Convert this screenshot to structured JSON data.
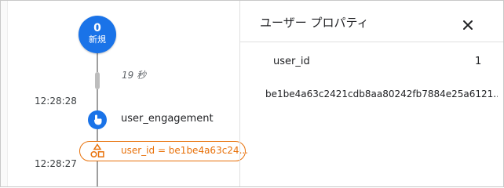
{
  "timeline": {
    "node_count": "0",
    "node_label": "新規",
    "gap_label": "19 秒",
    "events": [
      {
        "time": "12:28:28",
        "name": "user_engagement",
        "icon": "touch-icon"
      },
      {
        "time": "12:28:27",
        "property": "user_id = be1be4a63c24...",
        "icon": "shapes-icon"
      }
    ]
  },
  "panel": {
    "title": "ユーザー プロパティ",
    "close_icon": "close-icon",
    "property": {
      "key": "user_id",
      "count": "1",
      "value": "be1be4a63c2421cdb8aa80242fb7884e25a6121..."
    }
  },
  "colors": {
    "primary": "#1a73e8",
    "accent_orange": "#e8710a",
    "line_gray": "#9e9e9e"
  }
}
